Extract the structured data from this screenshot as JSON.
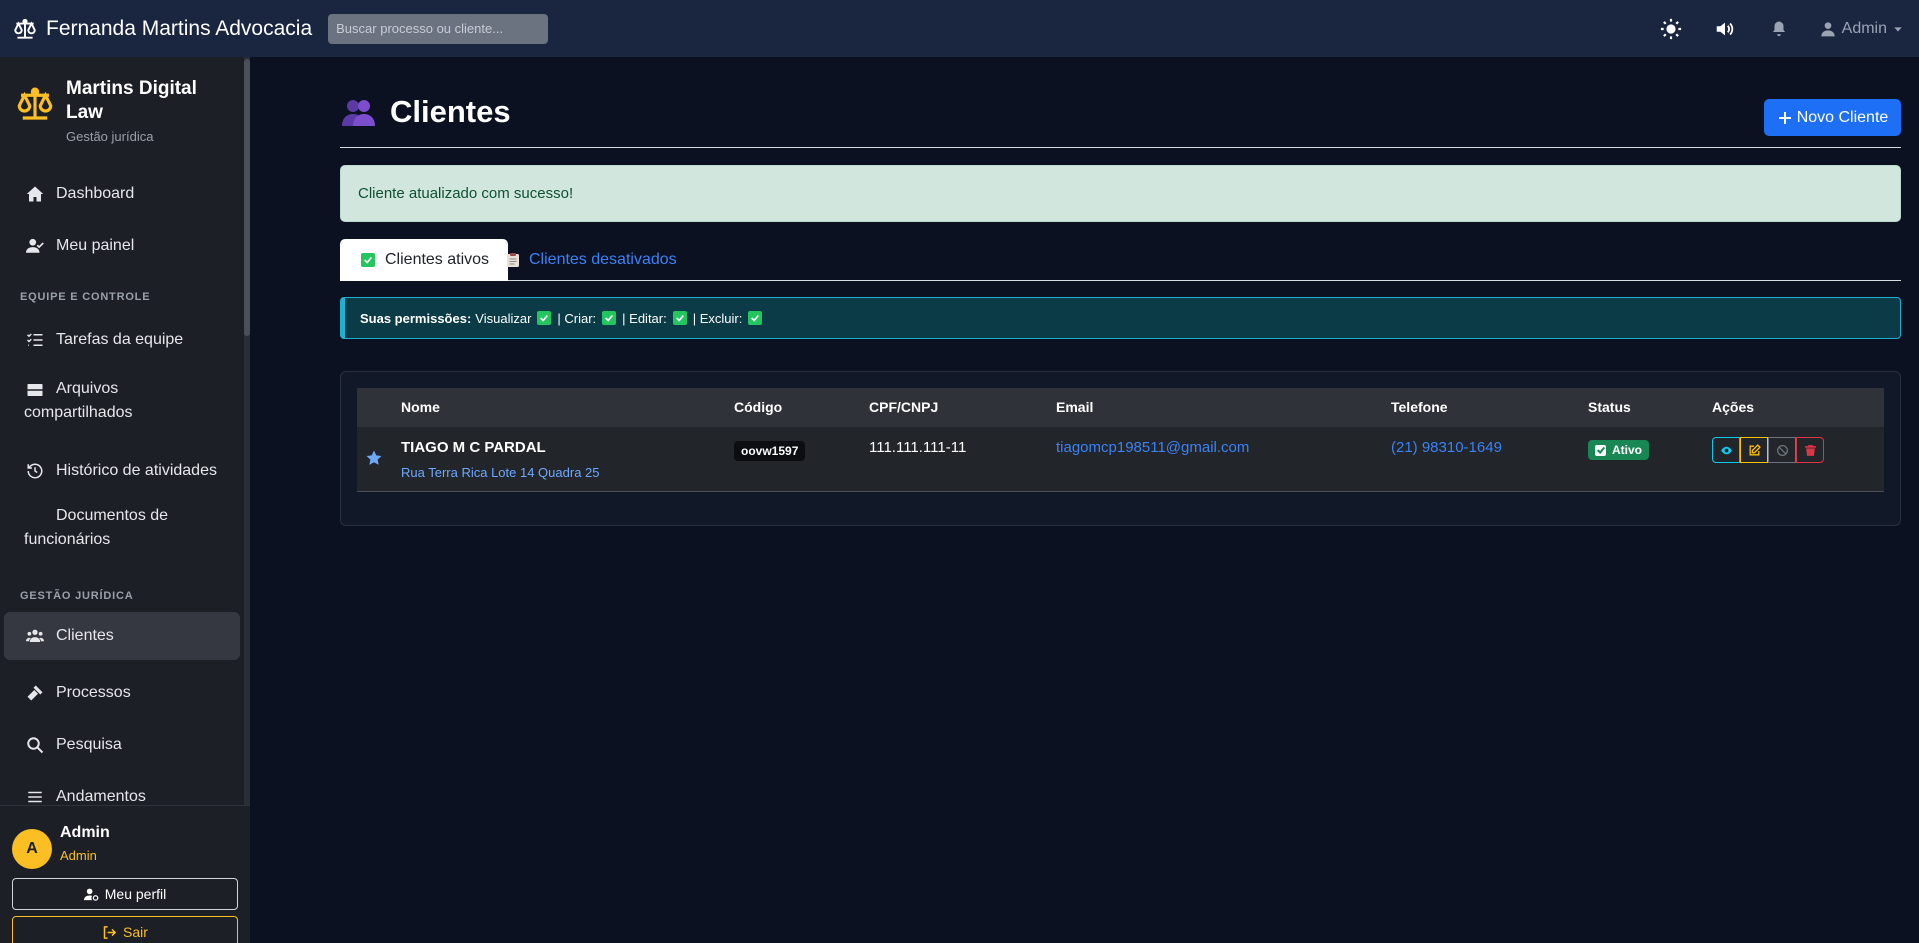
{
  "topbar": {
    "brand": "Fernanda Martins Advocacia",
    "search_placeholder": "Buscar processo ou cliente...",
    "admin_label": "Admin"
  },
  "sidebar": {
    "brand_title": "Martins Digital Law",
    "brand_subtitle": "Gestão jurídica",
    "items": [
      {
        "label": "Dashboard",
        "icon": "home-icon"
      },
      {
        "label": "Meu painel",
        "icon": "user-check-icon"
      },
      {
        "label": "Tarefas da equipe",
        "icon": "list-check-icon"
      },
      {
        "label": "Arquivos compartilhados",
        "icon": "hdd-icon"
      },
      {
        "label": "Histórico de atividades",
        "icon": "history-icon"
      },
      {
        "label": "Documentos de funcionários",
        "icon": ""
      },
      {
        "label": "Clientes",
        "icon": "users-icon"
      },
      {
        "label": "Processos",
        "icon": "gavel-icon"
      },
      {
        "label": "Pesquisa",
        "icon": "search-icon"
      },
      {
        "label": "Andamentos",
        "icon": "bars-icon"
      }
    ],
    "sections": [
      "EQUIPE E CONTROLE",
      "GESTÃO JURÍDICA"
    ],
    "active_item": "Clientes",
    "user": {
      "initial": "A",
      "name": "Admin",
      "role": "Admin"
    },
    "profile_button": "Meu perfil",
    "logout_button": "Sair"
  },
  "main": {
    "title": "Clientes",
    "new_button": "Novo Cliente",
    "alert": "Cliente atualizado com sucesso!",
    "tabs": [
      {
        "label": "Clientes ativos",
        "active": true
      },
      {
        "label": "Clientes desativados",
        "active": false
      }
    ],
    "permissions": {
      "prefix": "Suas permissões:",
      "items": [
        "Visualizar",
        "| Criar:",
        "| Editar:",
        "| Excluir:"
      ]
    },
    "table": {
      "columns": [
        "Nome",
        "Código",
        "CPF/CNPJ",
        "Email",
        "Telefone",
        "Status",
        "Ações"
      ],
      "rows": [
        {
          "name": "TIAGO M C PARDAL",
          "address": "Rua Terra Rica Lote 14 Quadra 25",
          "code": "oovw1597",
          "cpf": "111.111.111-11",
          "email": "tiagomcp198511@gmail.com",
          "phone": "(21) 98310-1649",
          "status": "Ativo"
        }
      ]
    }
  },
  "colors": {
    "topbar": "#1a2540",
    "sidebar": "#1c1f26",
    "page": "#0b1120",
    "accent": "#1d6ff5",
    "warning": "#fbbf24",
    "success": "#198754",
    "info": "#1fb0cf"
  }
}
